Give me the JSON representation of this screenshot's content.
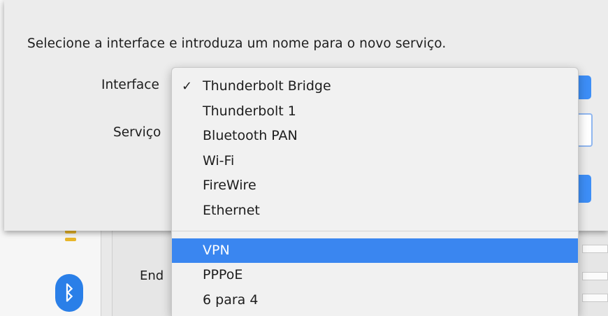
{
  "sheet": {
    "prompt": "Selecione a interface e introduza um nome para o novo serviço.",
    "interface_label": "Interface",
    "service_label": "Serviço"
  },
  "background": {
    "address_label_fragment": "End"
  },
  "menu": {
    "items": [
      {
        "label": "Thunderbolt Bridge",
        "checked": true
      },
      {
        "label": "Thunderbolt 1"
      },
      {
        "label": "Bluetooth PAN"
      },
      {
        "label": "Wi-Fi"
      },
      {
        "label": "FireWire"
      },
      {
        "label": "Ethernet"
      }
    ],
    "items_secondary": [
      {
        "label": "VPN",
        "highlighted": true
      },
      {
        "label": "PPPoE"
      },
      {
        "label": "6 para 4"
      }
    ],
    "check_glyph": "✓"
  },
  "colors": {
    "accent": "#3a86f0",
    "bluetooth": "#2a7fe8"
  },
  "icons": {
    "bluetooth": "bluetooth-icon"
  }
}
